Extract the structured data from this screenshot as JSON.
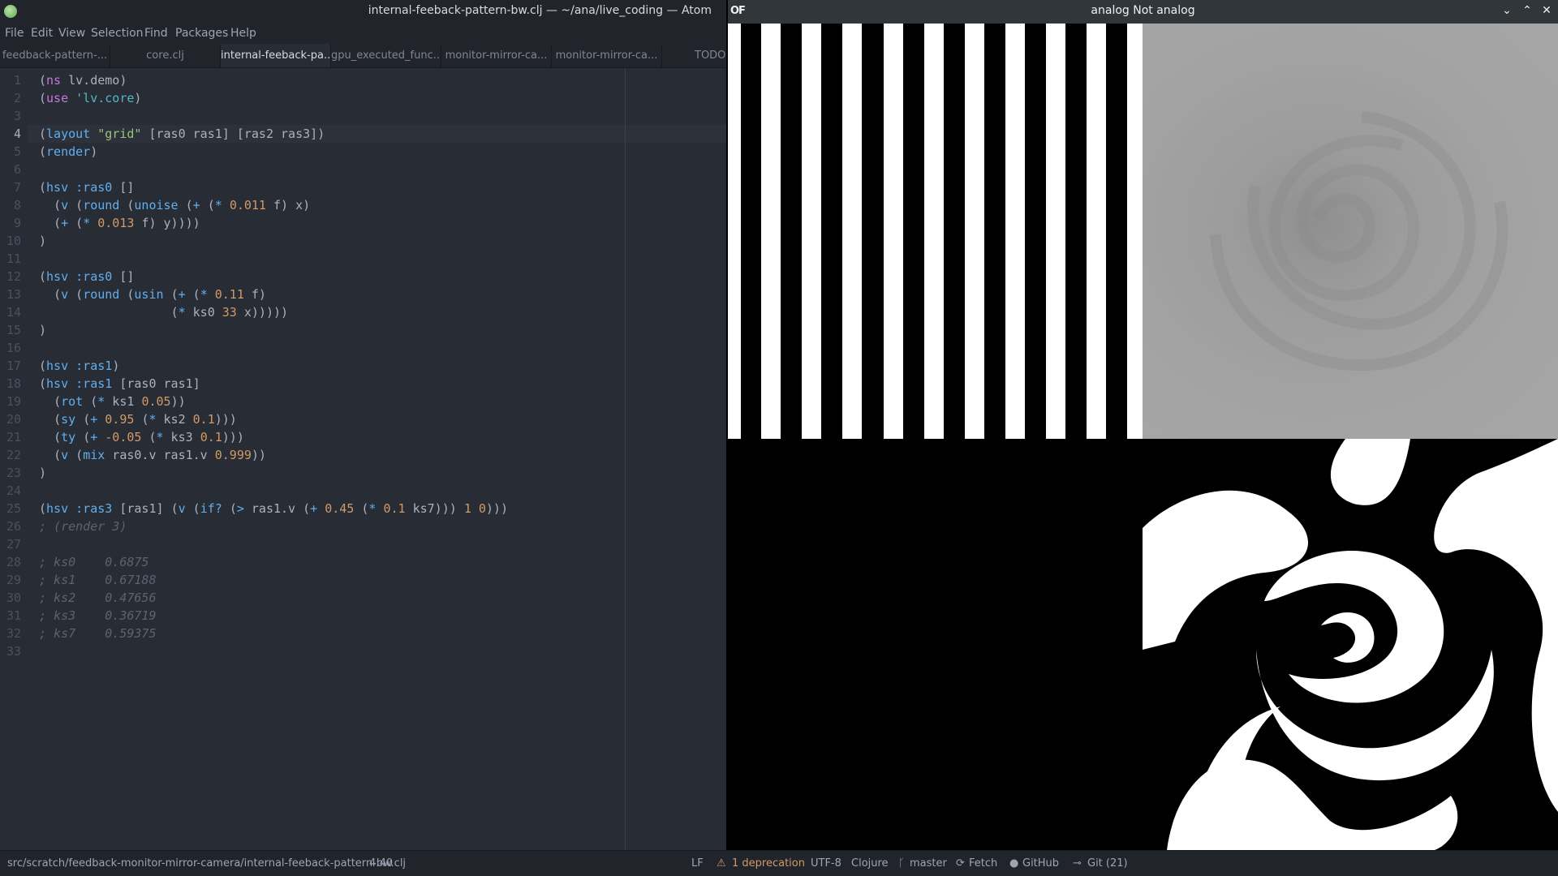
{
  "atom": {
    "title": "internal-feeback-pattern-bw.clj — ~/ana/live_coding — Atom",
    "menu": [
      "File",
      "Edit",
      "View",
      "Selection",
      "Find",
      "Packages",
      "Help"
    ],
    "tabs": [
      {
        "label": "feedback-pattern-...",
        "active": false
      },
      {
        "label": "core.clj",
        "active": false
      },
      {
        "label": "internal-feeback-pa...",
        "active": true
      },
      {
        "label": "gpu_executed_func...",
        "active": false
      },
      {
        "label": "monitor-mirror-ca...",
        "active": false
      },
      {
        "label": "monitor-mirror-ca...",
        "active": false
      },
      {
        "label": "TODO",
        "active": false
      }
    ],
    "current_line": 4,
    "code_lines": [
      [
        [
          "p",
          "("
        ],
        [
          "kw",
          "ns"
        ],
        [
          "id",
          " lv.demo"
        ],
        [
          "p",
          ")"
        ]
      ],
      [
        [
          "p",
          "("
        ],
        [
          "kw",
          "use"
        ],
        [
          "id",
          " "
        ],
        [
          "sym",
          "'lv.core"
        ],
        [
          "p",
          ")"
        ]
      ],
      [],
      [
        [
          "p",
          "("
        ],
        [
          "fn",
          "layout"
        ],
        [
          "id",
          " "
        ],
        [
          "str",
          "\"grid\""
        ],
        [
          "id",
          " [ras0 ras1] [ras2 ras3]"
        ],
        [
          "p",
          ")"
        ]
      ],
      [
        [
          "p",
          "("
        ],
        [
          "fn",
          "render"
        ],
        [
          "p",
          ")"
        ]
      ],
      [],
      [
        [
          "p",
          "("
        ],
        [
          "fn",
          "hsv"
        ],
        [
          "id",
          " "
        ],
        [
          "fn",
          ":ras0"
        ],
        [
          "id",
          " []"
        ]
      ],
      [
        [
          "id",
          "  "
        ],
        [
          "p",
          "("
        ],
        [
          "fn",
          "v"
        ],
        [
          "id",
          " "
        ],
        [
          "p",
          "("
        ],
        [
          "fn",
          "round"
        ],
        [
          "id",
          " "
        ],
        [
          "p",
          "("
        ],
        [
          "fn",
          "unoise"
        ],
        [
          "id",
          " "
        ],
        [
          "p",
          "("
        ],
        [
          "fn",
          "+"
        ],
        [
          "id",
          " "
        ],
        [
          "p",
          "("
        ],
        [
          "fn",
          "*"
        ],
        [
          "id",
          " "
        ],
        [
          "num",
          "0.011"
        ],
        [
          "id",
          " f) x)"
        ]
      ],
      [
        [
          "id",
          "  "
        ],
        [
          "p",
          "("
        ],
        [
          "fn",
          "+"
        ],
        [
          "id",
          " "
        ],
        [
          "p",
          "("
        ],
        [
          "fn",
          "*"
        ],
        [
          "id",
          " "
        ],
        [
          "num",
          "0.013"
        ],
        [
          "id",
          " f) y))))"
        ]
      ],
      [
        [
          "p",
          ")"
        ]
      ],
      [],
      [
        [
          "p",
          "("
        ],
        [
          "fn",
          "hsv"
        ],
        [
          "id",
          " "
        ],
        [
          "fn",
          ":ras0"
        ],
        [
          "id",
          " []"
        ]
      ],
      [
        [
          "id",
          "  "
        ],
        [
          "p",
          "("
        ],
        [
          "fn",
          "v"
        ],
        [
          "id",
          " "
        ],
        [
          "p",
          "("
        ],
        [
          "fn",
          "round"
        ],
        [
          "id",
          " "
        ],
        [
          "p",
          "("
        ],
        [
          "fn",
          "usin"
        ],
        [
          "id",
          " "
        ],
        [
          "p",
          "("
        ],
        [
          "fn",
          "+"
        ],
        [
          "id",
          " "
        ],
        [
          "p",
          "("
        ],
        [
          "fn",
          "*"
        ],
        [
          "id",
          " "
        ],
        [
          "num",
          "0.11"
        ],
        [
          "id",
          " f)"
        ]
      ],
      [
        [
          "id",
          "                  "
        ],
        [
          "p",
          "("
        ],
        [
          "fn",
          "*"
        ],
        [
          "id",
          " ks0 "
        ],
        [
          "num",
          "33"
        ],
        [
          "id",
          " x)))))"
        ]
      ],
      [
        [
          "p",
          ")"
        ]
      ],
      [],
      [
        [
          "p",
          "("
        ],
        [
          "fn",
          "hsv"
        ],
        [
          "id",
          " "
        ],
        [
          "fn",
          ":ras1"
        ],
        [
          "p",
          ")"
        ]
      ],
      [
        [
          "p",
          "("
        ],
        [
          "fn",
          "hsv"
        ],
        [
          "id",
          " "
        ],
        [
          "fn",
          ":ras1"
        ],
        [
          "id",
          " [ras0 ras1]"
        ]
      ],
      [
        [
          "id",
          "  "
        ],
        [
          "p",
          "("
        ],
        [
          "fn",
          "rot"
        ],
        [
          "id",
          " "
        ],
        [
          "p",
          "("
        ],
        [
          "fn",
          "*"
        ],
        [
          "id",
          " ks1 "
        ],
        [
          "num",
          "0.05"
        ],
        [
          "id",
          "))"
        ]
      ],
      [
        [
          "id",
          "  "
        ],
        [
          "p",
          "("
        ],
        [
          "fn",
          "sy"
        ],
        [
          "id",
          " "
        ],
        [
          "p",
          "("
        ],
        [
          "fn",
          "+"
        ],
        [
          "id",
          " "
        ],
        [
          "num",
          "0.95"
        ],
        [
          "id",
          " "
        ],
        [
          "p",
          "("
        ],
        [
          "fn",
          "*"
        ],
        [
          "id",
          " ks2 "
        ],
        [
          "num",
          "0.1"
        ],
        [
          "id",
          ")))"
        ]
      ],
      [
        [
          "id",
          "  "
        ],
        [
          "p",
          "("
        ],
        [
          "fn",
          "ty"
        ],
        [
          "id",
          " "
        ],
        [
          "p",
          "("
        ],
        [
          "fn",
          "+"
        ],
        [
          "id",
          " "
        ],
        [
          "num",
          "-0.05"
        ],
        [
          "id",
          " "
        ],
        [
          "p",
          "("
        ],
        [
          "fn",
          "*"
        ],
        [
          "id",
          " ks3 "
        ],
        [
          "num",
          "0.1"
        ],
        [
          "id",
          ")))"
        ]
      ],
      [
        [
          "id",
          "  "
        ],
        [
          "p",
          "("
        ],
        [
          "fn",
          "v"
        ],
        [
          "id",
          " "
        ],
        [
          "p",
          "("
        ],
        [
          "fn",
          "mix"
        ],
        [
          "id",
          " ras0.v ras1.v "
        ],
        [
          "num",
          "0.999"
        ],
        [
          "id",
          "))"
        ]
      ],
      [
        [
          "p",
          ")"
        ]
      ],
      [],
      [
        [
          "p",
          "("
        ],
        [
          "fn",
          "hsv"
        ],
        [
          "id",
          " "
        ],
        [
          "fn",
          ":ras3"
        ],
        [
          "id",
          " [ras1] "
        ],
        [
          "p",
          "("
        ],
        [
          "fn",
          "v"
        ],
        [
          "id",
          " "
        ],
        [
          "p",
          "("
        ],
        [
          "fn",
          "if?"
        ],
        [
          "id",
          " "
        ],
        [
          "p",
          "("
        ],
        [
          "fn",
          ">"
        ],
        [
          "id",
          " ras1.v "
        ],
        [
          "p",
          "("
        ],
        [
          "fn",
          "+"
        ],
        [
          "id",
          " "
        ],
        [
          "num",
          "0.45"
        ],
        [
          "id",
          " "
        ],
        [
          "p",
          "("
        ],
        [
          "fn",
          "*"
        ],
        [
          "id",
          " "
        ],
        [
          "num",
          "0.1"
        ],
        [
          "id",
          " ks7))) "
        ],
        [
          "num",
          "1"
        ],
        [
          "id",
          " "
        ],
        [
          "num",
          "0"
        ],
        [
          "id",
          ")))"
        ]
      ],
      [
        [
          "cm",
          "; (render 3)"
        ]
      ],
      [],
      [
        [
          "cm",
          "; ks0    0.6875"
        ]
      ],
      [
        [
          "cm",
          "; ks1    0.67188"
        ]
      ],
      [
        [
          "cm",
          "; ks2    0.47656"
        ]
      ],
      [
        [
          "cm",
          "; ks3    0.36719"
        ]
      ],
      [
        [
          "cm",
          "; ks7    0.59375"
        ]
      ],
      []
    ]
  },
  "status": {
    "path": "src/scratch/feedback-monitor-mirror-camera/internal-feeback-pattern-bw.clj",
    "cursor": "4:40",
    "line_ending": "LF",
    "deprecation": "1 deprecation",
    "encoding": "UTF-8",
    "grammar": "Clojure",
    "branch": "master",
    "fetch": "Fetch",
    "github": "GitHub",
    "git": "Git (21)"
  },
  "of_window": {
    "logo": "OF",
    "title": "analog Not analog",
    "minimize": "⌄",
    "maximize": "⌃",
    "close": "✕"
  },
  "colors": {
    "editor_bg": "#282c34",
    "chrome_bg": "#21252b",
    "keyword": "#c678dd",
    "function": "#61afef",
    "string": "#98c379",
    "number": "#d19a66",
    "comment": "#5c6370"
  }
}
